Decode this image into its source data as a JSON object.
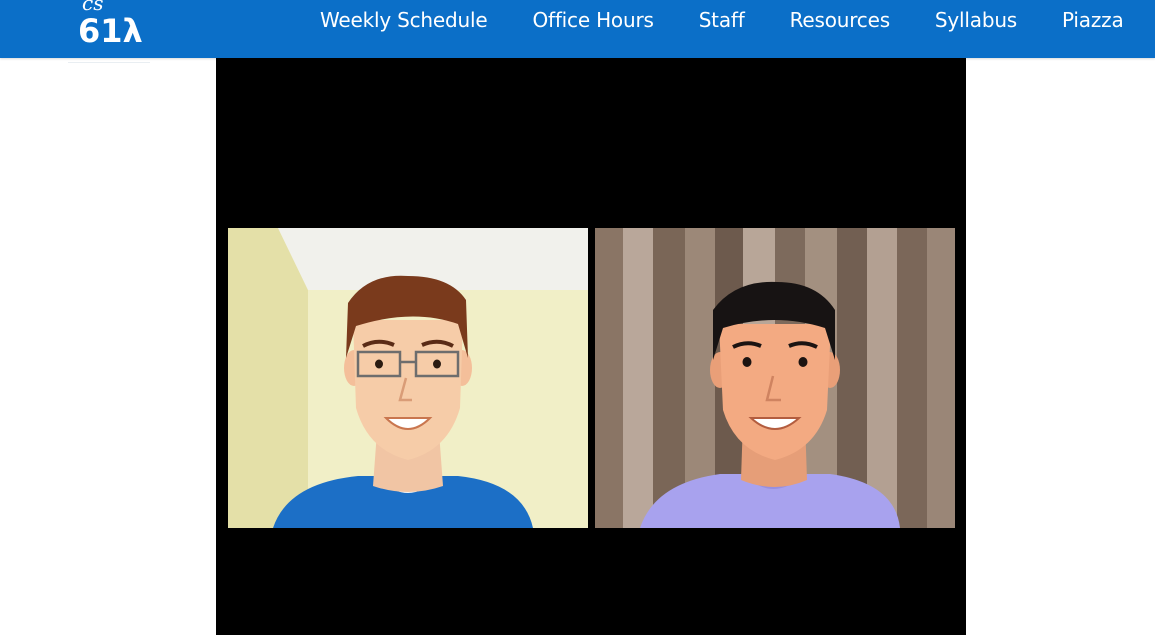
{
  "logo": {
    "script_text": "cs",
    "course_text": "61λ"
  },
  "nav": {
    "items": [
      {
        "label": "Weekly Schedule"
      },
      {
        "label": "Office Hours"
      },
      {
        "label": "Staff"
      },
      {
        "label": "Resources"
      },
      {
        "label": "Syllabus"
      },
      {
        "label": "Piazza"
      }
    ]
  },
  "colors": {
    "navbar": "#0b6fc8",
    "video_background": "#000000",
    "left_shirt": "#1c6fc6",
    "right_shirt": "#a8a2ee",
    "left_wall": "#eeecbe",
    "right_wall_stripes": "#8a7565"
  },
  "video": {
    "participants": [
      {
        "avatar_icon": "person-with-glasses-icon"
      },
      {
        "avatar_icon": "person-icon"
      }
    ]
  }
}
